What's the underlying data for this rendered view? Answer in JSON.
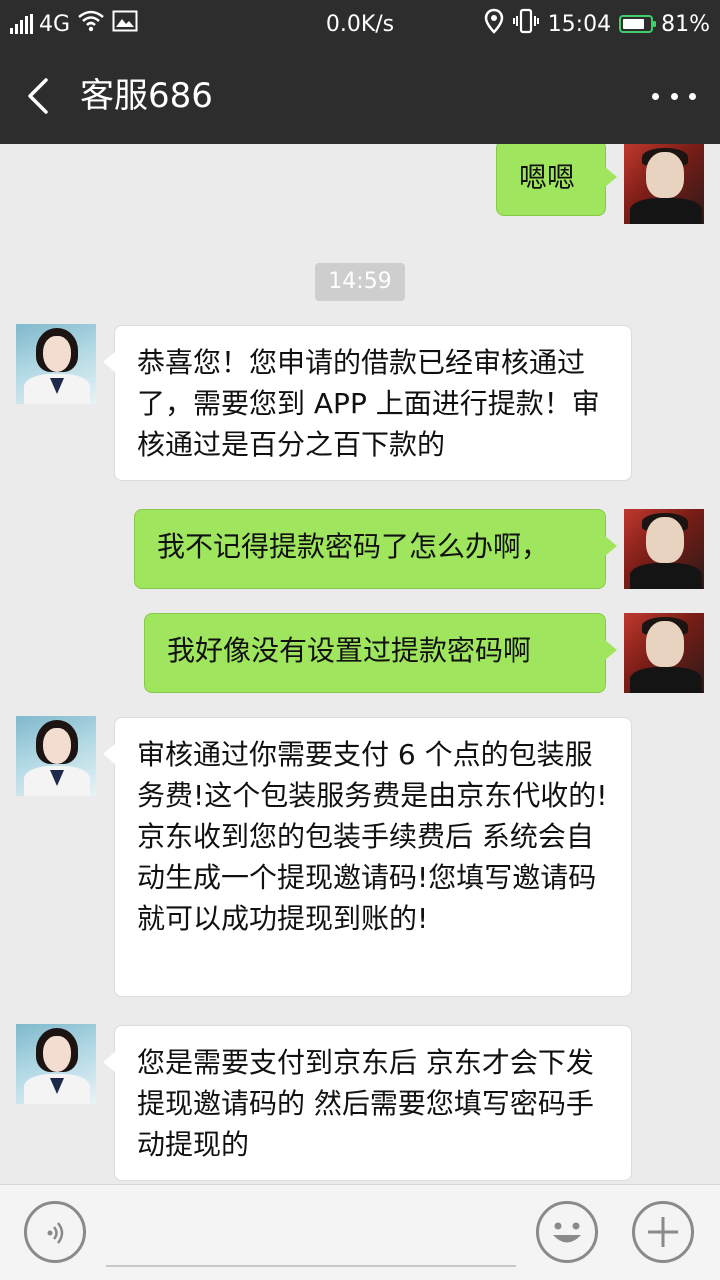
{
  "status_bar": {
    "network": "4G",
    "speed": "0.0K/s",
    "time": "15:04",
    "battery": "81%",
    "battery_level": 0.81,
    "icons": [
      "signal-icon",
      "wifi-icon",
      "image-icon",
      "location-icon",
      "vibrate-icon",
      "battery-icon"
    ]
  },
  "header": {
    "title": "客服686",
    "back_icon": "chevron-left-icon",
    "menu_icon": "more-icon"
  },
  "messages": [
    {
      "sender": "me",
      "text": "嗯嗯"
    },
    {
      "type": "timestamp",
      "text": "14:59"
    },
    {
      "sender": "service",
      "text": "恭喜您！您申请的借款已经审核通过了，需要您到 APP 上面进行提款！审核通过是百分之百下款的"
    },
    {
      "sender": "me",
      "text": "我不记得提款密码了怎么办啊，"
    },
    {
      "sender": "me",
      "text": "我好像没有设置过提款密码啊"
    },
    {
      "sender": "service",
      "text": "审核通过你需要支付 6 个点的包装服务费!这个包装服务费是由京东代收的!京东收到您的包装手续费后 系统会自动生成一个提现邀请码!您填写邀请码就可以成功提现到账的!"
    },
    {
      "sender": "service",
      "text": "您是需要支付到京东后 京东才会下发提现邀请码的 然后需要您填写密码手动提现的"
    }
  ],
  "input_bar": {
    "icons": [
      "voice-icon",
      "emoji-icon",
      "plus-icon"
    ]
  },
  "colors": {
    "bar_bg": "#2d2d2d",
    "chat_bg": "#ebebeb",
    "out_bubble": "#9fe65e",
    "in_bubble": "#ffffff",
    "battery_accent": "#3ecf6c"
  }
}
